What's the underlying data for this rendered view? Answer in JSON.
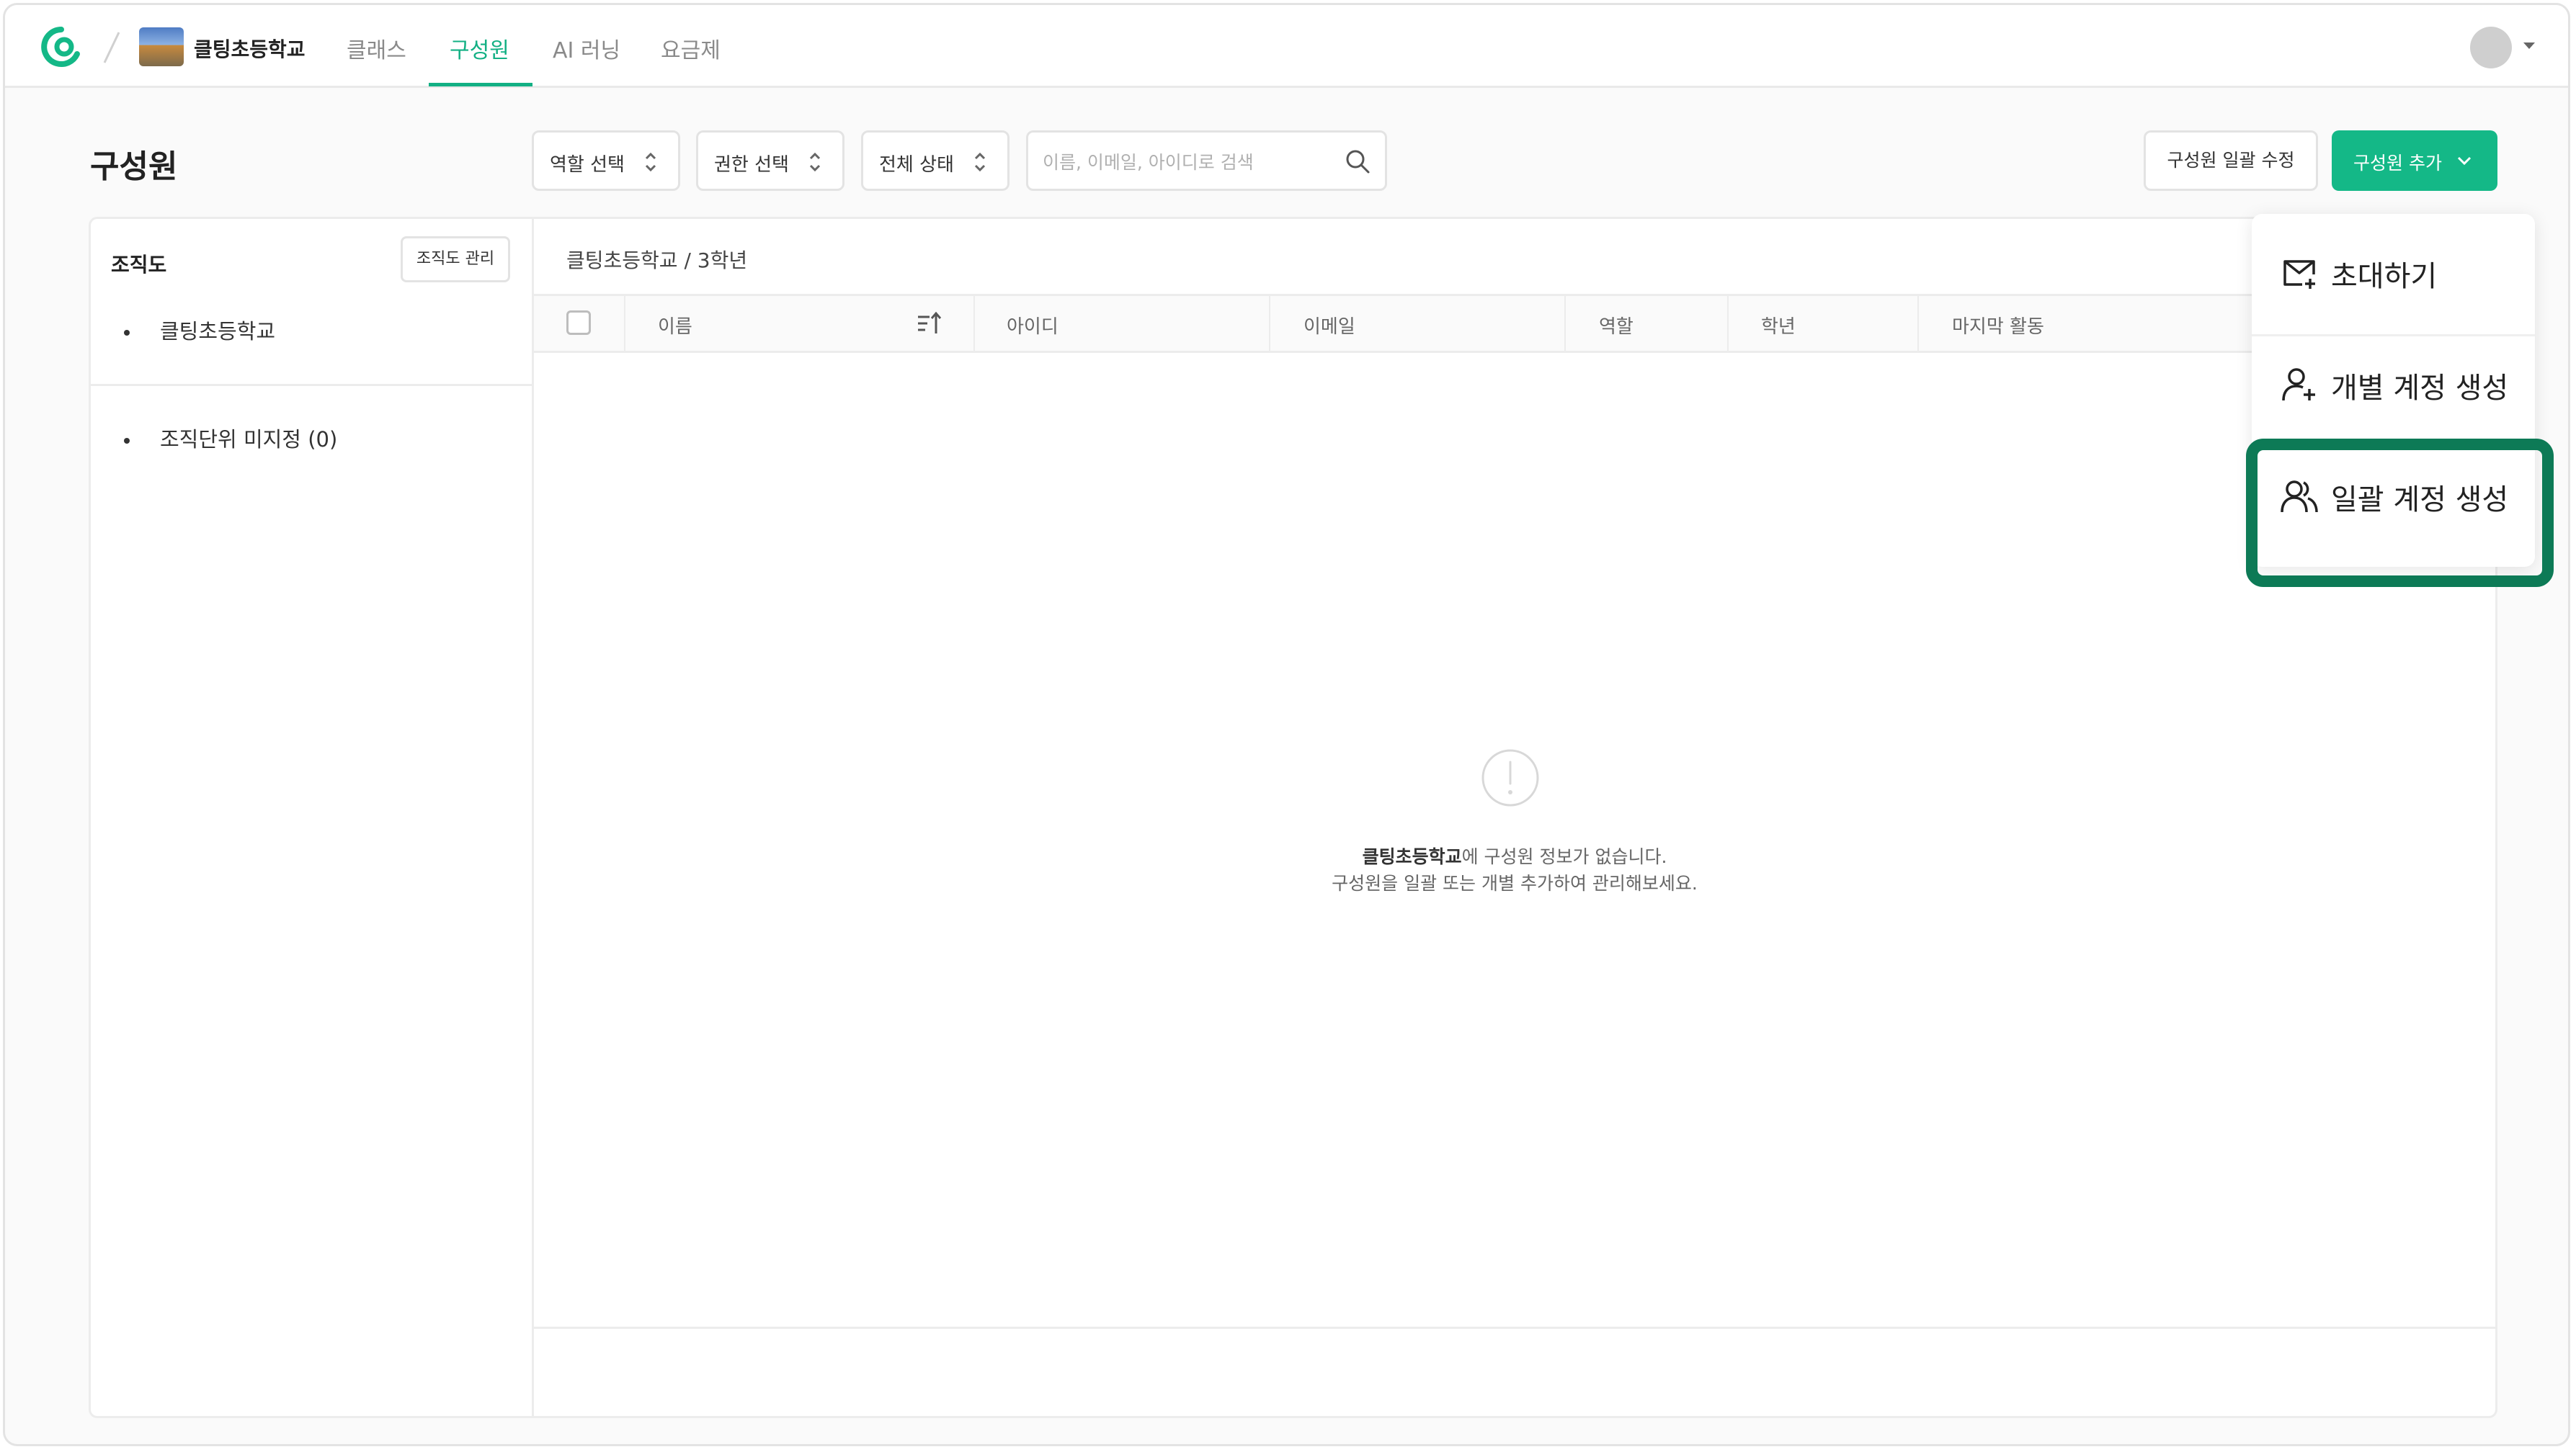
{
  "topnav": {
    "school_name": "클팅초등학교",
    "tabs": [
      {
        "label": "클래스",
        "active": false
      },
      {
        "label": "구성원",
        "active": true
      },
      {
        "label": "AI 러닝",
        "active": false
      },
      {
        "label": "요금제",
        "active": false
      }
    ],
    "accent_color": "#13b084"
  },
  "header": {
    "title": "구성원",
    "filters": [
      {
        "label": "역할 선택"
      },
      {
        "label": "권한 선택"
      },
      {
        "label": "전체 상태"
      }
    ],
    "search_placeholder": "이름, 이메일, 아이디로 검색",
    "bulk_edit_label": "구성원 일괄 수정",
    "add_member_label": "구성원 추가"
  },
  "org": {
    "title": "조직도",
    "manage_label": "조직도 관리",
    "items": [
      "클팅초등학교",
      "조직단위 미지정 (0)"
    ]
  },
  "main": {
    "breadcrumb": "클팅초등학교 / 3학년",
    "columns": [
      "이름",
      "아이디",
      "이메일",
      "역할",
      "학년",
      "마지막 활동"
    ],
    "empty_school": "클팅초등학교",
    "empty_line1_rest": "에 구성원 정보가 없습니다.",
    "empty_line2": "구성원을 일괄 또는 개별 추가하여 관리해보세요."
  },
  "dropdown": {
    "items": [
      {
        "label": "초대하기",
        "icon": "mail-plus-icon"
      },
      {
        "label": "개별 계정 생성",
        "icon": "user-plus-icon"
      },
      {
        "label": "일괄 계정 생성",
        "icon": "users-icon"
      }
    ],
    "highlight_color": "#0d7a56"
  }
}
